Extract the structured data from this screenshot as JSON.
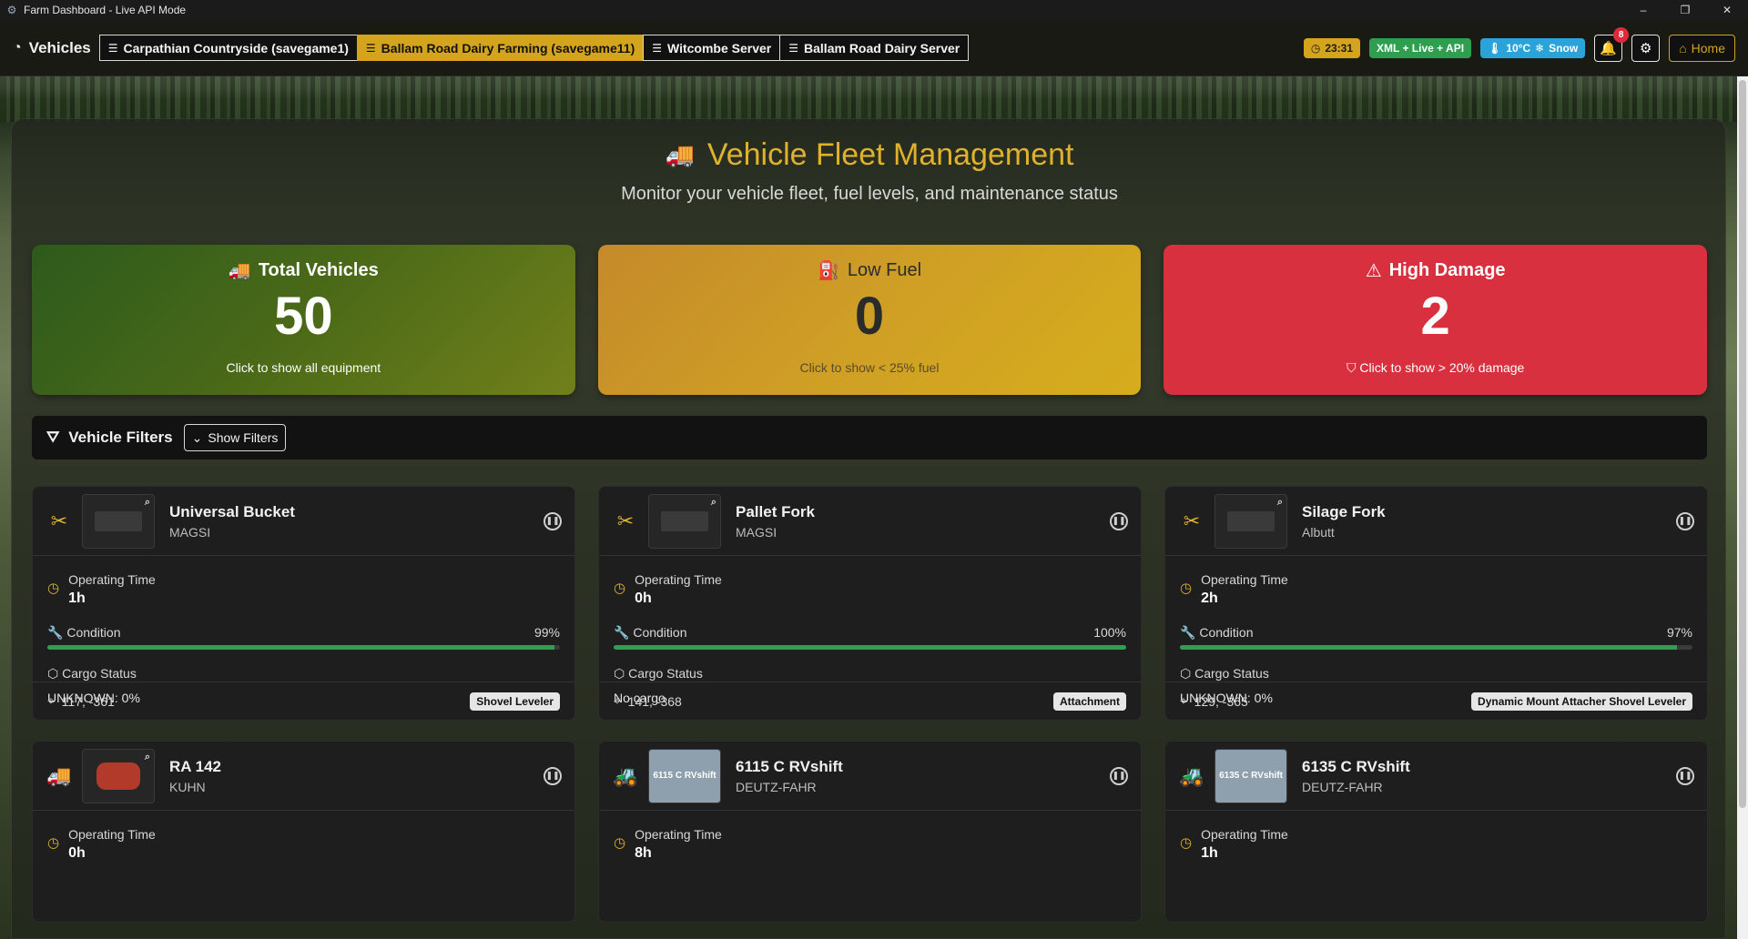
{
  "window": {
    "title": "Farm Dashboard - Live API Mode",
    "minimize": "–",
    "maximize": "❐",
    "close": "✕"
  },
  "nav": {
    "brand": "Vehicles",
    "tabs": [
      {
        "label": "Carpathian Countryside (savegame1)",
        "active": false
      },
      {
        "label": "Ballam Road Dairy Farming (savegame11)",
        "active": true
      },
      {
        "label": "Witcombe Server",
        "active": false
      },
      {
        "label": "Ballam Road Dairy Server",
        "active": false
      }
    ],
    "time": "23:31",
    "api_mode": "XML + Live + API",
    "weather_temp": "10°C",
    "weather_cond": "Snow",
    "notifications_count": "8",
    "home_label": "Home"
  },
  "header": {
    "title": "Vehicle Fleet Management",
    "subtitle": "Monitor your vehicle fleet, fuel levels, and maintenance status"
  },
  "stats": {
    "total": {
      "title": "Total Vehicles",
      "value": "50",
      "hint": "Click to show all equipment"
    },
    "low_fuel": {
      "title": "Low Fuel",
      "value": "0",
      "hint": "Click to show < 25% fuel"
    },
    "high_damage": {
      "title": "High Damage",
      "value": "2",
      "hint": "Click to show > 20% damage"
    }
  },
  "filters": {
    "label": "Vehicle Filters",
    "button": "Show Filters"
  },
  "labels": {
    "operating_time": "Operating Time",
    "condition": "Condition",
    "cargo_status": "Cargo Status"
  },
  "vehicles": [
    {
      "name": "Universal Bucket",
      "brand": "MAGSI",
      "hours": "1h",
      "condition": "99%",
      "condition_level": 0.99,
      "cargo": "UNKNOWN: 0%",
      "coords": "117, -361",
      "tag": "Shovel Leveler"
    },
    {
      "name": "Pallet Fork",
      "brand": "MAGSI",
      "hours": "0h",
      "condition": "100%",
      "condition_level": 1.0,
      "cargo": "No cargo",
      "coords": "141, -368",
      "tag": "Attachment"
    },
    {
      "name": "Silage Fork",
      "brand": "Albutt",
      "hours": "2h",
      "condition": "97%",
      "condition_level": 0.97,
      "cargo": "UNKNOWN: 0%",
      "coords": "129, -365",
      "tag": "Dynamic Mount Attacher Shovel Leveler"
    },
    {
      "name": "RA 142",
      "brand": "KUHN",
      "hours": "0h"
    },
    {
      "name": "6115 C RVshift",
      "brand": "DEUTZ-FAHR",
      "hours": "8h",
      "thumb_text": "6115 C RVshift"
    },
    {
      "name": "6135 C RVshift",
      "brand": "DEUTZ-FAHR",
      "hours": "1h",
      "thumb_text": "6135 C RVshift"
    }
  ]
}
